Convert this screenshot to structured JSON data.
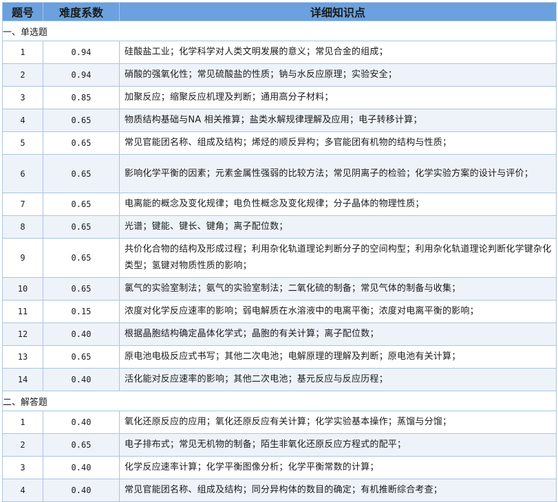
{
  "header": {
    "col_num": "题号",
    "col_difficulty": "难度系数",
    "col_knowledge": "详细知识点"
  },
  "sections": [
    {
      "title": "一、单选题",
      "rows": [
        {
          "num": "1",
          "difficulty": "0.94",
          "knowledge": "硅酸盐工业；化学科学对人类文明发展的意义；常见合金的组成；"
        },
        {
          "num": "2",
          "difficulty": "0.94",
          "knowledge": "硝酸的强氧化性；常见硫酸盐的性质；钠与水反应原理；实验安全；"
        },
        {
          "num": "3",
          "difficulty": "0.85",
          "knowledge": "加聚反应；缩聚反应机理及判断；通用高分子材料；"
        },
        {
          "num": "4",
          "difficulty": "0.65",
          "knowledge": "物质结构基础与NA 相关推算；盐类水解规律理解及应用；电子转移计算；"
        },
        {
          "num": "5",
          "difficulty": "0.65",
          "knowledge": "常见官能团名称、组成及结构；烯烃的顺反异构；多官能团有机物的结构与性质；"
        },
        {
          "num": "6",
          "difficulty": "0.65",
          "knowledge": "影响化学平衡的因素；元素金属性强弱的比较方法；常见阴离子的检验；化学实验方案的设计与评价；"
        },
        {
          "num": "7",
          "difficulty": "0.65",
          "knowledge": "电离能的概念及变化规律；电负性概念及变化规律；分子晶体的物理性质；"
        },
        {
          "num": "8",
          "difficulty": "0.65",
          "knowledge": "光谱；键能、键长、键角；离子配位数；"
        },
        {
          "num": "9",
          "difficulty": "0.65",
          "knowledge": "共价化合物的结构及形成过程；利用杂化轨道理论判断分子的空间构型；利用杂化轨道理论判断化学键杂化类型；氢键对物质性质的影响；"
        },
        {
          "num": "10",
          "difficulty": "0.65",
          "knowledge": "氯气的实验室制法；氨气的实验室制法；二氧化硫的制备；常见气体的制备与收集；"
        },
        {
          "num": "11",
          "difficulty": "0.15",
          "knowledge": "浓度对化学反应速率的影响；弱电解质在水溶液中的电离平衡；浓度对电离平衡的影响；"
        },
        {
          "num": "12",
          "difficulty": "0.40",
          "knowledge": "根据晶胞结构确定晶体化学式；晶胞的有关计算；离子配位数；"
        },
        {
          "num": "13",
          "difficulty": "0.65",
          "knowledge": "原电池电极反应式书写；其他二次电池；电解原理的理解及判断；原电池有关计算；"
        },
        {
          "num": "14",
          "difficulty": "0.40",
          "knowledge": "活化能对反应速率的影响；其他二次电池；基元反应与反应历程；"
        }
      ]
    },
    {
      "title": "二、解答题",
      "rows": [
        {
          "num": "1",
          "difficulty": "0.40",
          "knowledge": "氧化还原反应的应用；氧化还原反应有关计算；化学实验基本操作；蒸馏与分馏；"
        },
        {
          "num": "2",
          "difficulty": "0.65",
          "knowledge": "电子排布式；常见无机物的制备；陌生非氧化还原反应方程式的配平；"
        },
        {
          "num": "3",
          "difficulty": "0.40",
          "knowledge": "化学反应速率计算；化学平衡图像分析；化学平衡常数的计算；"
        },
        {
          "num": "4",
          "difficulty": "0.40",
          "knowledge": "常见官能团名称、组成及结构；同分异构体的数目的确定；有机推断综合考查；"
        }
      ]
    }
  ]
}
